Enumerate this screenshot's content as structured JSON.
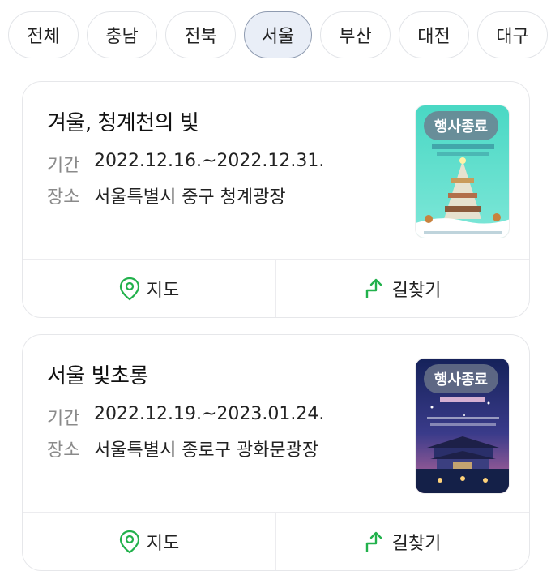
{
  "filters": {
    "chips": [
      "전체",
      "충남",
      "전북",
      "서울",
      "부산",
      "대전",
      "대구"
    ],
    "selected": "서울"
  },
  "events": [
    {
      "title": "겨울, 청계천의 빛",
      "period_label": "기간",
      "period": "2022.12.16.~2022.12.31.",
      "venue_label": "장소",
      "venue": "서울특별시 중구 청계광장",
      "badge": "행사종료",
      "map_label": "지도",
      "directions_label": "길찾기"
    },
    {
      "title": "서울 빛초롱",
      "period_label": "기간",
      "period": "2022.12.19.~2023.01.24.",
      "venue_label": "장소",
      "venue": "서울특별시 종로구 광화문광장",
      "badge": "행사종료",
      "map_label": "지도",
      "directions_label": "길찾기"
    }
  ],
  "colors": {
    "chip_active_bg": "#e9eef7",
    "action_icon": "#22b14c",
    "badge_bg": "#6e788c"
  }
}
